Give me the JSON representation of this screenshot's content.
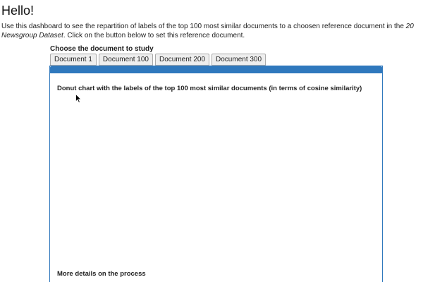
{
  "header": {
    "title": "Hello!"
  },
  "intro": {
    "text_before": "Use this dashboard to see the repartition of labels of the top 100 most similar documents to a choosen reference document in the ",
    "dataset_name": "20 Newsgroup Dataset",
    "text_after": ". Click on the button below to set this reference document."
  },
  "selector": {
    "label": "Choose the document to study",
    "tabs": [
      {
        "label": "Document 1"
      },
      {
        "label": "Document 100"
      },
      {
        "label": "Document 200"
      },
      {
        "label": "Document 300"
      }
    ]
  },
  "panel": {
    "accent_color": "#2f78bd",
    "donut_title": "Donut chart with the labels of the top 100 most similar documents (in terms of cosine similarity)",
    "details_title": "More details on the process"
  },
  "cursor": {
    "icon": "arrow-cursor-icon"
  }
}
